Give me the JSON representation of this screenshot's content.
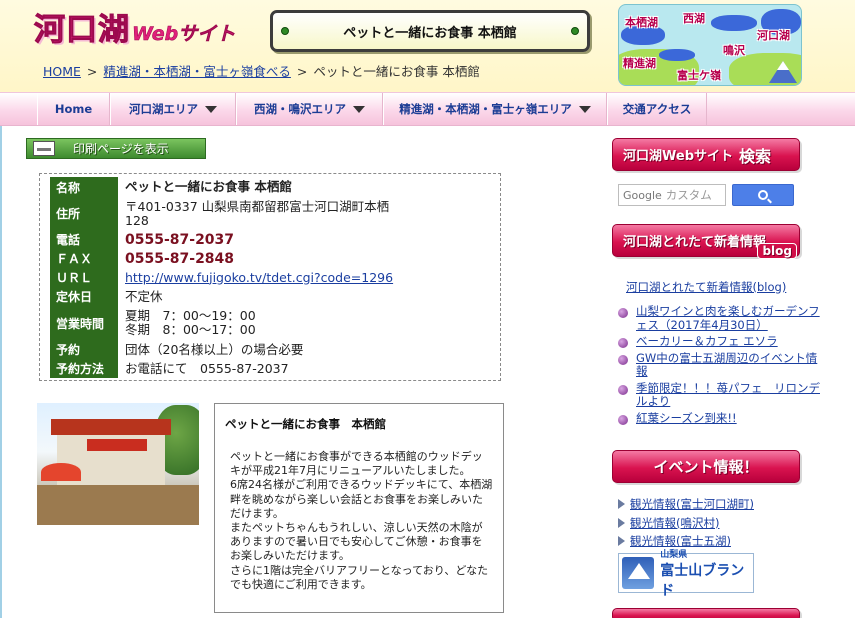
{
  "header": {
    "logo_main": "河口湖",
    "logo_sub": "Webサイト",
    "page_banner": "ペットと一緒にお食事 本栖館"
  },
  "breadcrumb": {
    "home": "HOME",
    "section": "精進湖・本栖湖・富士ヶ嶺食べる",
    "current": "ペットと一緒にお食事 本栖館",
    "separator": ">"
  },
  "map": {
    "labels": [
      "本栖湖",
      "西湖",
      "河口湖",
      "鳴沢",
      "精進湖",
      "富士ケ嶺"
    ]
  },
  "nav": {
    "items": [
      {
        "label": "Home",
        "dropdown": false
      },
      {
        "label": "河口湖エリア",
        "dropdown": true
      },
      {
        "label": "西湖・鳴沢エリア",
        "dropdown": true
      },
      {
        "label": "精進湖・本栖湖・富士ヶ嶺エリア",
        "dropdown": true
      },
      {
        "label": "交通アクセス",
        "dropdown": false
      }
    ]
  },
  "print_button": "印刷ページを表示",
  "info": {
    "rows": [
      {
        "key": "名称",
        "value": "ペットと一緒にお食事 本栖館"
      },
      {
        "key": "住所",
        "value": "〒401-0337 山梨県南都留郡富士河口湖町本栖128"
      },
      {
        "key": "電話",
        "value": "0555-87-2037"
      },
      {
        "key": "ＦＡＸ",
        "value": "0555-87-2848"
      },
      {
        "key": "ＵＲＬ",
        "value": "http://www.fujigoko.tv/tdet.cgi?code=1296"
      },
      {
        "key": "定休日",
        "value": "不定休"
      },
      {
        "key": "営業時間",
        "value_line1": "夏期　7：00～19：00",
        "value_line2": "冬期　8：00～17：00"
      },
      {
        "key": "予約",
        "value": "団体（20名様以上）の場合必要"
      },
      {
        "key": "予約方法",
        "value": "お電話にて　0555-87-2037"
      }
    ]
  },
  "description": {
    "title": "ペットと一緒にお食事　本栖館",
    "text": "ペットと一緒にお食事ができる本栖館のウッドデッキが平成21年7月にリニューアルいたしました。\n6席24名様がご利用できるウッドデッキにて、本栖湖畔を眺めながら楽しい会話とお食事をお楽しみいただけます。\nまたペットちゃんもうれしい、涼しい天然の木陰がありますので暑い日でも安心してご休憩・お食事をお楽しみいただけます。\nさらに1階は完全バリアフリーとなっており、どなたでも快適にご利用できます。"
  },
  "sidebar": {
    "search_banner_text": "河口湖Webサイト",
    "search_banner_big": "検索",
    "search_placeholder": "カスタム",
    "search_brand": "Google",
    "news_banner": "河口湖とれたて新着情報",
    "news_badge": "blog",
    "blog_link": "河口湖とれたて新着情報(blog)",
    "news_items": [
      "山梨ワインと肉を楽しむガーデンフェス（2017年4月30日）",
      "ベーカリー＆カフェ エソラ",
      "GW中の富士五湖周辺のイベント情報",
      "季節限定！！！苺パフェ　リロンデルより",
      "紅葉シーズン到来!!"
    ],
    "event_banner": "イベント情報！",
    "event_items": [
      "観光情報(富士河口湖町)",
      "観光情報(鳴沢村)",
      "観光情報(富士五湖)"
    ],
    "brand_pref": "山梨県",
    "brand_name": "富士山ブランド"
  }
}
